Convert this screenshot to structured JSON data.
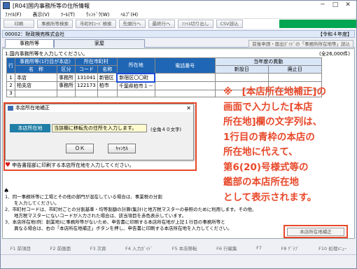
{
  "window": {
    "title": "[R04]国内事務所等の住所情報"
  },
  "menu": [
    "ﾌｧｲﾙ(F)",
    "表示(V)",
    "ﾂｰﾙ(T)",
    "ｳｨﾝﾄﾞｳ(W)",
    "ﾍﾙﾌﾟ(H)"
  ],
  "toolbar": [
    "印刷",
    "事務所等検索",
    "市町村ｺｰﾄﾞ検索",
    "先頭行へ",
    "最終行へ",
    "ﾌｧｲﾙ切り出し",
    "CSV読込"
  ],
  "docbar": {
    "left": "00002：財政検売株式会社",
    "right": "【令和４年度】"
  },
  "tabs": {
    "tab1": "事務所等",
    "tab2": "家屋",
    "button": "前後申請・届出ｶﾞｲﾄﾞの「事務所所在地等」読込"
  },
  "info": {
    "line": "1.国内事務所等を入力してください。",
    "right": "(全26,000件)"
  },
  "table": {
    "header1": [
      "行",
      "事務所等(1行目が本店)",
      "所在市町村",
      "所在地",
      "電話番号",
      "当年度の異動"
    ],
    "header2": [
      "名　称",
      "区分",
      "コード",
      "名称",
      "新設日",
      "廃止日"
    ],
    "rows": [
      {
        "no": "1",
        "name": "本店",
        "kind": "事務所",
        "code": "131041",
        "city": "新宿区",
        "addr": "新宿区〇〇町"
      },
      {
        "no": "2",
        "name": "柏支店",
        "kind": "事務所",
        "code": "122173",
        "city": "柏市",
        "addr": "千葉県柏市１－"
      },
      {
        "no": "3",
        "name": "",
        "kind": "",
        "code": "",
        "city": "",
        "addr": ""
      }
    ]
  },
  "dialog": {
    "title": "本店所在地補正",
    "label": "本店所在地",
    "value": "当該欄に移転先の住所を入力します。",
    "limit": "(全角４０文字)",
    "ok": "ＯＫ",
    "cancel": "ｷｬﾝｾﾙ"
  },
  "heart_text": "申告書揺部に印刷する本店所在地を入力してください。",
  "callout": [
    "※　[本店所在地補正]の",
    "画面で入力した[本店",
    "所在地]欄の文字列は、",
    "1行目の青枠の本店の",
    "所在地に代えて、",
    "第6(20)号様式等の",
    "鑑部の本店所在地",
    "として表示されます。"
  ],
  "notes": [
    "1．同一事務所等に工場とその他の部門が混在している場合は、事業税の分割",
    "　　を入力してください。",
    "2．市町村コードは、市町村ごとの分割基準・均等割額の計算(集計)と地方税マスターの参照のために利用します。その他、",
    "　　地方税マスターにないコードが入力された場合は、該当項目を赤色表示しています。",
    "3．本店所在地(例：創業地)に事務所等がないため、申告書に印刷する本店所在地が上記１行目の事務所等と",
    "　　異なる場合は、右の「本店所在地補正」ボタンを押し、申告書に印刷する本店所在地を入力してください。"
  ],
  "buttons": {
    "honten": "本店所在地補正"
  },
  "fkeys": [
    "F1 前項目",
    "F2 前画面",
    "F3 次頁",
    "F4 入力ｶﾞｲﾄﾞ",
    "F5 本店移転",
    "F6 行編集",
    "F7",
    "F8 ｸﾞﾗﾌﾞ",
    "F10 処理ﾒﾆｭｰ"
  ],
  "colors": {
    "accent": "#00a651",
    "callout": "#e8482a",
    "header": "#1f66b5"
  }
}
